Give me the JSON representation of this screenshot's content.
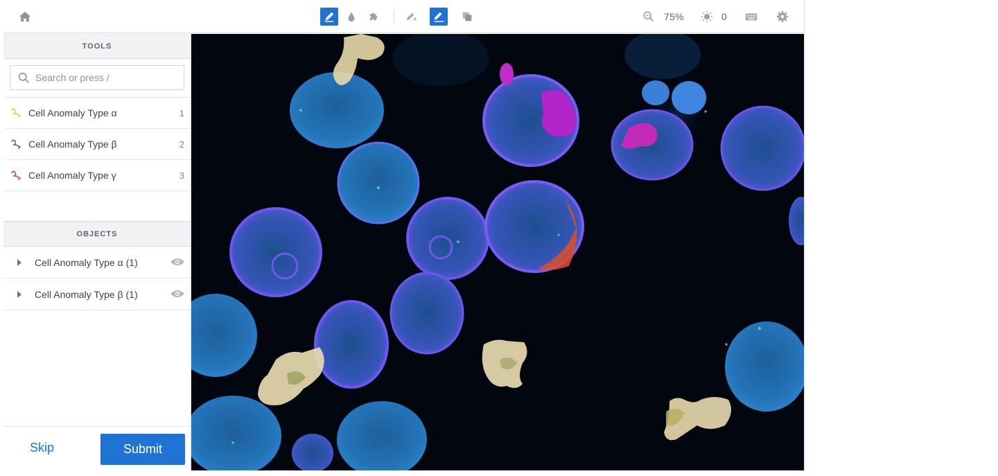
{
  "toolbar": {
    "zoom": "75%",
    "brightness": "0",
    "icons": [
      "home-icon",
      "pen-icon",
      "drop-icon",
      "puzzle-icon",
      "pen-plus-icon",
      "pen-minus-icon",
      "layers-icon",
      "zoom-icon",
      "brightness-icon",
      "keyboard-icon",
      "gear-icon"
    ],
    "accent": "#1f73d3"
  },
  "sidebar": {
    "tools_heading": "TOOLS",
    "search_placeholder": "Search or press /",
    "tools": [
      {
        "label": "Cell Anomaly Type α",
        "key": "1",
        "color": "#f0c94a"
      },
      {
        "label": "Cell Anomaly Type β",
        "key": "2",
        "color": "#8a44c4"
      },
      {
        "label": "Cell Anomaly Type γ",
        "key": "3",
        "color": "#c43aa8"
      }
    ],
    "objects_heading": "OBJECTS",
    "objects": [
      {
        "label": "Cell Anomaly Type α (1)"
      },
      {
        "label": "Cell Anomaly Type β (1)"
      }
    ],
    "skip_label": "Skip",
    "submit_label": "Submit"
  }
}
